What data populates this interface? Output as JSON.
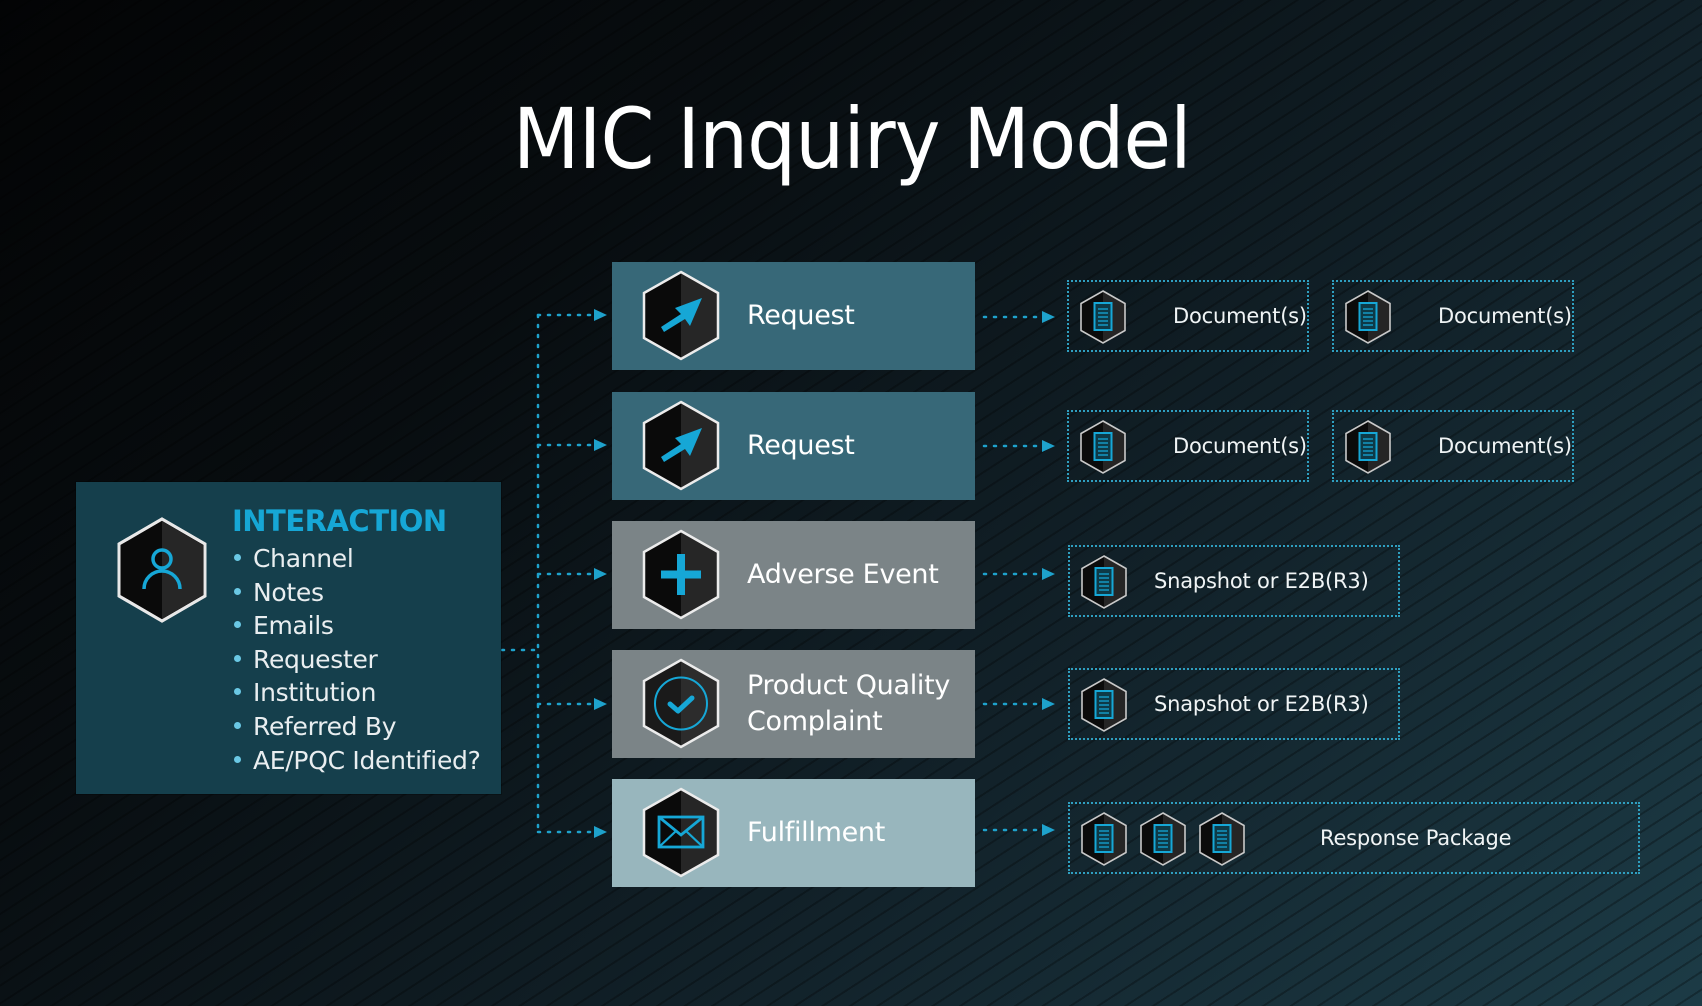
{
  "title": "MIC Inquiry Model",
  "colors": {
    "accent": "#16a7d6",
    "request_box": "#376878",
    "event_box": "#7b8487",
    "fulfillment_box": "#98b6bd",
    "interaction_box": "#153f4c"
  },
  "interaction": {
    "icon": "person-icon",
    "heading": "INTERACTION",
    "items": [
      "Channel",
      "Notes",
      "Emails",
      "Requester",
      "Institution",
      "Referred By",
      "AE/PQC Identified?"
    ]
  },
  "categories": [
    {
      "label": "Request",
      "icon": "cursor-arrow-icon",
      "outputs": [
        "Document(s)",
        "Document(s)"
      ]
    },
    {
      "label": "Request",
      "icon": "cursor-arrow-icon",
      "outputs": [
        "Document(s)",
        "Document(s)"
      ]
    },
    {
      "label": "Adverse Event",
      "icon": "plus-icon",
      "outputs": [
        "Snapshot or E2B(R3)"
      ]
    },
    {
      "label": "Product Quality Complaint",
      "label_lines": [
        "Product Quality",
        "Complaint"
      ],
      "icon": "check-circle-icon",
      "outputs": [
        "Snapshot or E2B(R3)"
      ]
    },
    {
      "label": "Fulfillment",
      "icon": "envelope-icon",
      "outputs": [
        "Response Package"
      ],
      "output_icon_count": 3
    }
  ]
}
